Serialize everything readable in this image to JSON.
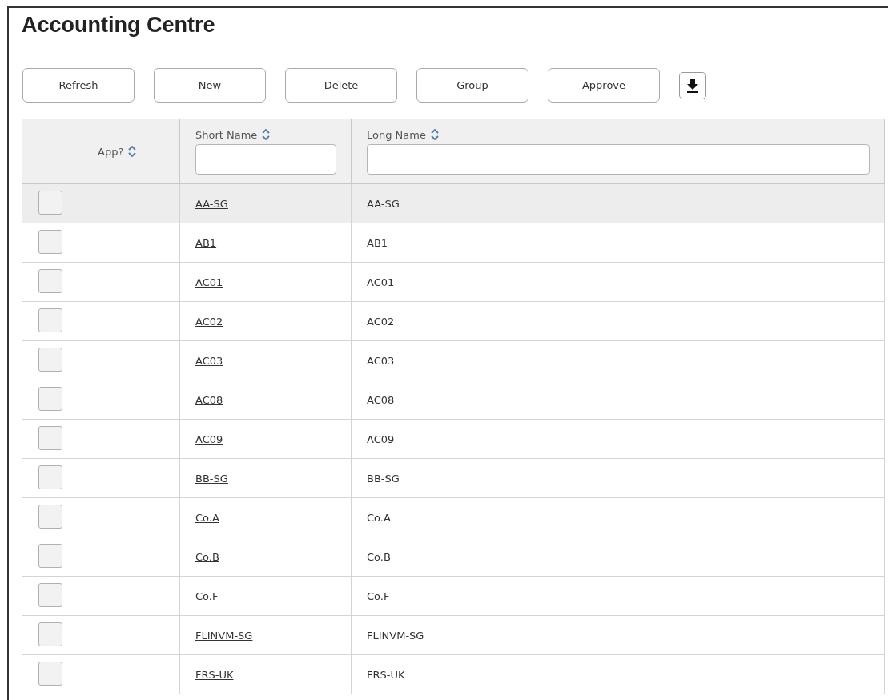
{
  "title": "Accounting Centre",
  "toolbar": {
    "buttons": [
      "Refresh",
      "New",
      "Delete",
      "Group",
      "Approve"
    ]
  },
  "table": {
    "columns": [
      {
        "kind": "check"
      },
      {
        "kind": "sort",
        "label": "App?"
      },
      {
        "kind": "filter",
        "label": "Short Name"
      },
      {
        "kind": "filter",
        "label": "Long Name"
      }
    ],
    "rows": [
      {
        "short_name": "AA-SG",
        "long_name": "AA-SG",
        "checked": false,
        "highlighted": true
      },
      {
        "short_name": "AB1",
        "long_name": "AB1",
        "checked": false,
        "highlighted": false
      },
      {
        "short_name": "AC01",
        "long_name": "AC01",
        "checked": false,
        "highlighted": false
      },
      {
        "short_name": "AC02",
        "long_name": "AC02",
        "checked": false,
        "highlighted": false
      },
      {
        "short_name": "AC03",
        "long_name": "AC03",
        "checked": false,
        "highlighted": false
      },
      {
        "short_name": "AC08",
        "long_name": "AC08",
        "checked": false,
        "highlighted": false
      },
      {
        "short_name": "AC09",
        "long_name": "AC09",
        "checked": false,
        "highlighted": false
      },
      {
        "short_name": "BB-SG",
        "long_name": "BB-SG",
        "checked": false,
        "highlighted": false
      },
      {
        "short_name": "Co.A",
        "long_name": "Co.A",
        "checked": false,
        "highlighted": false
      },
      {
        "short_name": "Co.B",
        "long_name": "Co.B",
        "checked": false,
        "highlighted": false
      },
      {
        "short_name": "Co.F",
        "long_name": "Co.F",
        "checked": false,
        "highlighted": false
      },
      {
        "short_name": "FLINVM-SG",
        "long_name": "FLINVM-SG",
        "checked": false,
        "highlighted": false
      },
      {
        "short_name": "FRS-UK",
        "long_name": "FRS-UK",
        "checked": false,
        "highlighted": false
      }
    ]
  }
}
